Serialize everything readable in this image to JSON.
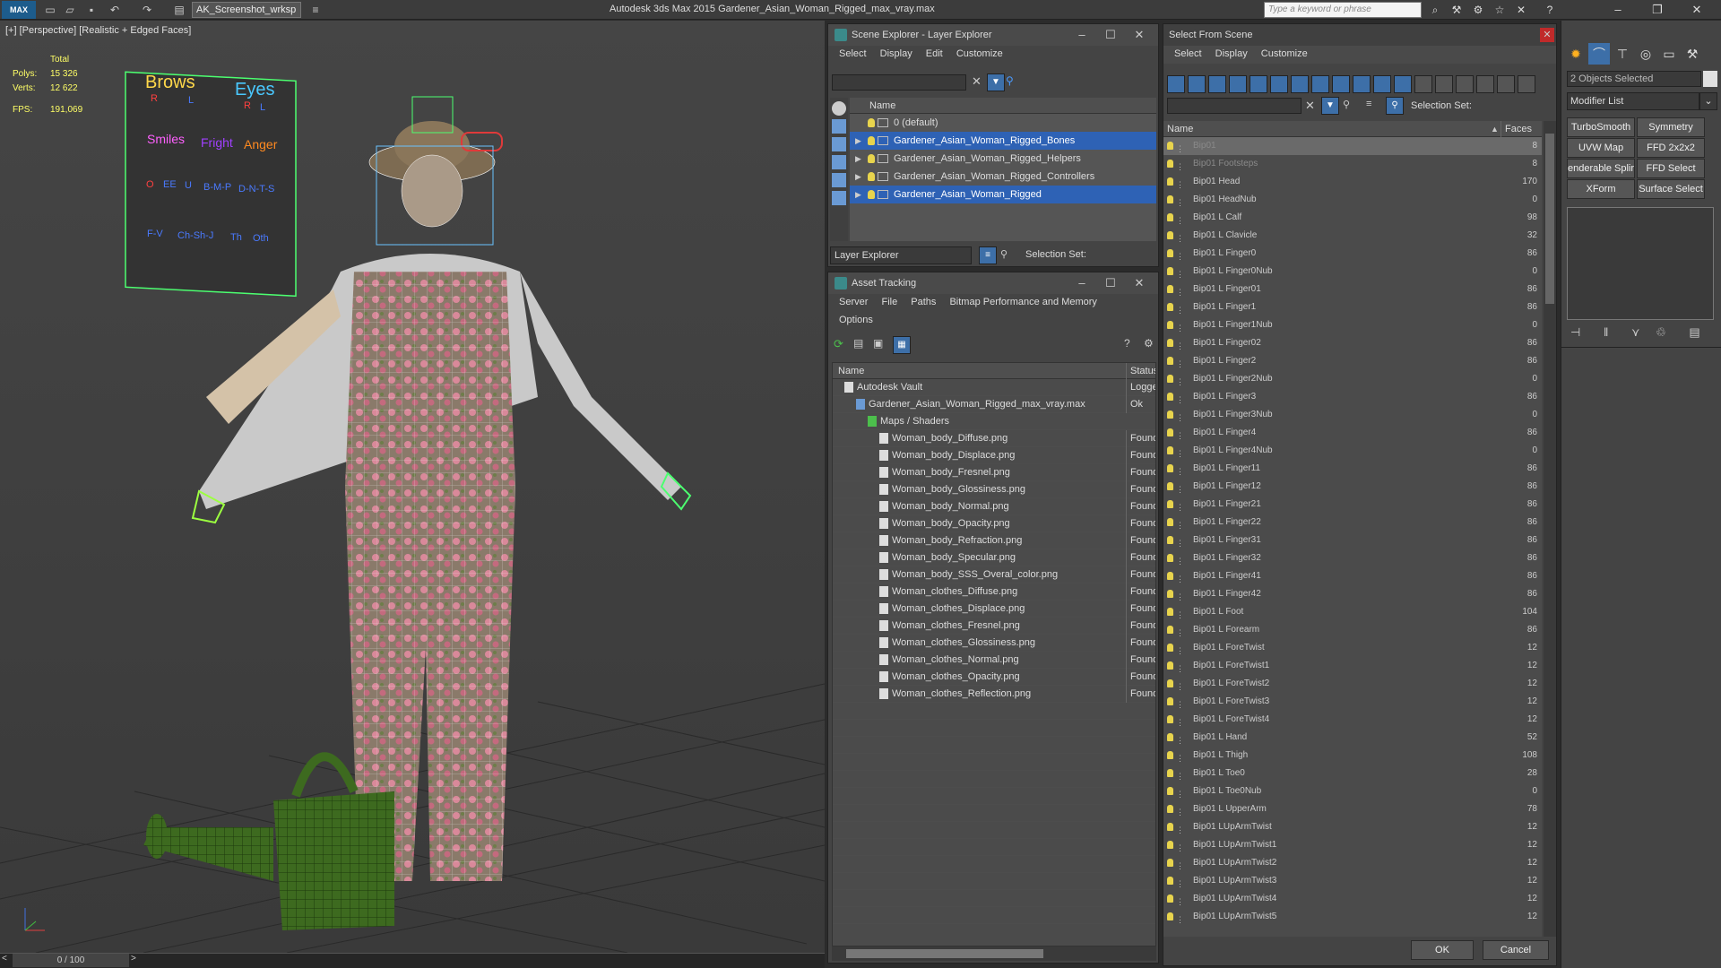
{
  "app": {
    "logo": "MAX",
    "workspace": "AK_Screenshot_wrksp",
    "title": "Autodesk 3ds Max  2015     Gardener_Asian_Woman_Rigged_max_vray.max",
    "search_placeholder": "Type a keyword or phrase"
  },
  "viewport": {
    "label": "[+] [Perspective] [Realistic + Edged Faces]",
    "stats_total_label": "Total",
    "polys_label": "Polys:",
    "polys_value": "15 326",
    "verts_label": "Verts:",
    "verts_value": "12 622",
    "fps_label": "FPS:",
    "fps_value": "191,069",
    "face_board": {
      "brows": "Brows",
      "eyes": "Eyes",
      "smiles": "Smiles",
      "anger": "Anger",
      "fright": "Fright",
      "r1": "R",
      "l1": "L",
      "r2": "R",
      "l2": "L",
      "o": "O",
      "ee": "EE",
      "u": "U",
      "bmp": "B-M-P",
      "dnts": "D-N-T-S",
      "fv": "F-V",
      "chshj": "Ch-Sh-J",
      "th": "Th",
      "oth": "Oth"
    },
    "timeslider": "0 / 100"
  },
  "scene_explorer": {
    "title": "Scene Explorer - Layer Explorer",
    "menu": [
      "Select",
      "Display",
      "Edit",
      "Customize"
    ],
    "column_name": "Name",
    "layers": [
      {
        "name": "0 (default)",
        "selected": false,
        "expand": false
      },
      {
        "name": "Gardener_Asian_Woman_Rigged_Bones",
        "selected": true,
        "expand": true
      },
      {
        "name": "Gardener_Asian_Woman_Rigged_Helpers",
        "selected": false,
        "expand": true
      },
      {
        "name": "Gardener_Asian_Woman_Rigged_Controllers",
        "selected": false,
        "expand": true
      },
      {
        "name": "Gardener_Asian_Woman_Rigged",
        "selected": true,
        "expand": true
      }
    ],
    "footer_dropdown": "Layer Explorer",
    "selection_set_label": "Selection Set:"
  },
  "asset_tracking": {
    "title": "Asset Tracking",
    "menu": [
      "Server",
      "File",
      "Paths",
      "Bitmap Performance and Memory"
    ],
    "menu2": [
      "Options"
    ],
    "col_name": "Name",
    "col_status": "Status",
    "rows": [
      {
        "name": "Autodesk Vault",
        "status": "Logged",
        "indent": 1,
        "icon": "vault"
      },
      {
        "name": "Gardener_Asian_Woman_Rigged_max_vray.max",
        "status": "Ok",
        "indent": 2,
        "icon": "max"
      },
      {
        "name": "Maps / Shaders",
        "status": "",
        "indent": 3,
        "icon": "maps"
      },
      {
        "name": "Woman_body_Diffuse.png",
        "status": "Found",
        "indent": 4,
        "icon": "img"
      },
      {
        "name": "Woman_body_Displace.png",
        "status": "Found",
        "indent": 4,
        "icon": "img"
      },
      {
        "name": "Woman_body_Fresnel.png",
        "status": "Found",
        "indent": 4,
        "icon": "img"
      },
      {
        "name": "Woman_body_Glossiness.png",
        "status": "Found",
        "indent": 4,
        "icon": "img"
      },
      {
        "name": "Woman_body_Normal.png",
        "status": "Found",
        "indent": 4,
        "icon": "img"
      },
      {
        "name": "Woman_body_Opacity.png",
        "status": "Found",
        "indent": 4,
        "icon": "img"
      },
      {
        "name": "Woman_body_Refraction.png",
        "status": "Found",
        "indent": 4,
        "icon": "img"
      },
      {
        "name": "Woman_body_Specular.png",
        "status": "Found",
        "indent": 4,
        "icon": "img"
      },
      {
        "name": "Woman_body_SSS_Overal_color.png",
        "status": "Found",
        "indent": 4,
        "icon": "img"
      },
      {
        "name": "Woman_clothes_Diffuse.png",
        "status": "Found",
        "indent": 4,
        "icon": "img"
      },
      {
        "name": "Woman_clothes_Displace.png",
        "status": "Found",
        "indent": 4,
        "icon": "img"
      },
      {
        "name": "Woman_clothes_Fresnel.png",
        "status": "Found",
        "indent": 4,
        "icon": "img"
      },
      {
        "name": "Woman_clothes_Glossiness.png",
        "status": "Found",
        "indent": 4,
        "icon": "img"
      },
      {
        "name": "Woman_clothes_Normal.png",
        "status": "Found",
        "indent": 4,
        "icon": "img"
      },
      {
        "name": "Woman_clothes_Opacity.png",
        "status": "Found",
        "indent": 4,
        "icon": "img"
      },
      {
        "name": "Woman_clothes_Reflection.png",
        "status": "Found",
        "indent": 4,
        "icon": "img"
      }
    ]
  },
  "select_from_scene": {
    "title": "Select From Scene",
    "menu": [
      "Select",
      "Display",
      "Customize"
    ],
    "selection_set_label": "Selection Set:",
    "col_name": "Name",
    "col_faces": "Faces",
    "ok": "OK",
    "cancel": "Cancel",
    "rows": [
      {
        "name": "Bip01",
        "faces": "8",
        "sel": true,
        "dim": true
      },
      {
        "name": "Bip01 Footsteps",
        "faces": "8",
        "dim": true
      },
      {
        "name": "Bip01 Head",
        "faces": "170"
      },
      {
        "name": "Bip01 HeadNub",
        "faces": "0"
      },
      {
        "name": "Bip01 L Calf",
        "faces": "98"
      },
      {
        "name": "Bip01 L Clavicle",
        "faces": "32"
      },
      {
        "name": "Bip01 L Finger0",
        "faces": "86"
      },
      {
        "name": "Bip01 L Finger0Nub",
        "faces": "0"
      },
      {
        "name": "Bip01 L Finger01",
        "faces": "86"
      },
      {
        "name": "Bip01 L Finger1",
        "faces": "86"
      },
      {
        "name": "Bip01 L Finger1Nub",
        "faces": "0"
      },
      {
        "name": "Bip01 L Finger02",
        "faces": "86"
      },
      {
        "name": "Bip01 L Finger2",
        "faces": "86"
      },
      {
        "name": "Bip01 L Finger2Nub",
        "faces": "0"
      },
      {
        "name": "Bip01 L Finger3",
        "faces": "86"
      },
      {
        "name": "Bip01 L Finger3Nub",
        "faces": "0"
      },
      {
        "name": "Bip01 L Finger4",
        "faces": "86"
      },
      {
        "name": "Bip01 L Finger4Nub",
        "faces": "0"
      },
      {
        "name": "Bip01 L Finger11",
        "faces": "86"
      },
      {
        "name": "Bip01 L Finger12",
        "faces": "86"
      },
      {
        "name": "Bip01 L Finger21",
        "faces": "86"
      },
      {
        "name": "Bip01 L Finger22",
        "faces": "86"
      },
      {
        "name": "Bip01 L Finger31",
        "faces": "86"
      },
      {
        "name": "Bip01 L Finger32",
        "faces": "86"
      },
      {
        "name": "Bip01 L Finger41",
        "faces": "86"
      },
      {
        "name": "Bip01 L Finger42",
        "faces": "86"
      },
      {
        "name": "Bip01 L Foot",
        "faces": "104"
      },
      {
        "name": "Bip01 L Forearm",
        "faces": "86"
      },
      {
        "name": "Bip01 L ForeTwist",
        "faces": "12"
      },
      {
        "name": "Bip01 L ForeTwist1",
        "faces": "12"
      },
      {
        "name": "Bip01 L ForeTwist2",
        "faces": "12"
      },
      {
        "name": "Bip01 L ForeTwist3",
        "faces": "12"
      },
      {
        "name": "Bip01 L ForeTwist4",
        "faces": "12"
      },
      {
        "name": "Bip01 L Hand",
        "faces": "52"
      },
      {
        "name": "Bip01 L Thigh",
        "faces": "108"
      },
      {
        "name": "Bip01 L Toe0",
        "faces": "28"
      },
      {
        "name": "Bip01 L Toe0Nub",
        "faces": "0"
      },
      {
        "name": "Bip01 L UpperArm",
        "faces": "78"
      },
      {
        "name": "Bip01 LUpArmTwist",
        "faces": "12"
      },
      {
        "name": "Bip01 LUpArmTwist1",
        "faces": "12"
      },
      {
        "name": "Bip01 LUpArmTwist2",
        "faces": "12"
      },
      {
        "name": "Bip01 LUpArmTwist3",
        "faces": "12"
      },
      {
        "name": "Bip01 LUpArmTwist4",
        "faces": "12"
      },
      {
        "name": "Bip01 LUpArmTwist5",
        "faces": "12"
      }
    ]
  },
  "command_panel": {
    "objects_selected": "2 Objects Selected",
    "modifier_list": "Modifier List",
    "buttons": [
      "TurboSmooth",
      "Symmetry",
      "UVW Map",
      "FFD 2x2x2",
      "enderable Splir",
      "FFD Select",
      "XForm",
      "Surface Select"
    ]
  }
}
